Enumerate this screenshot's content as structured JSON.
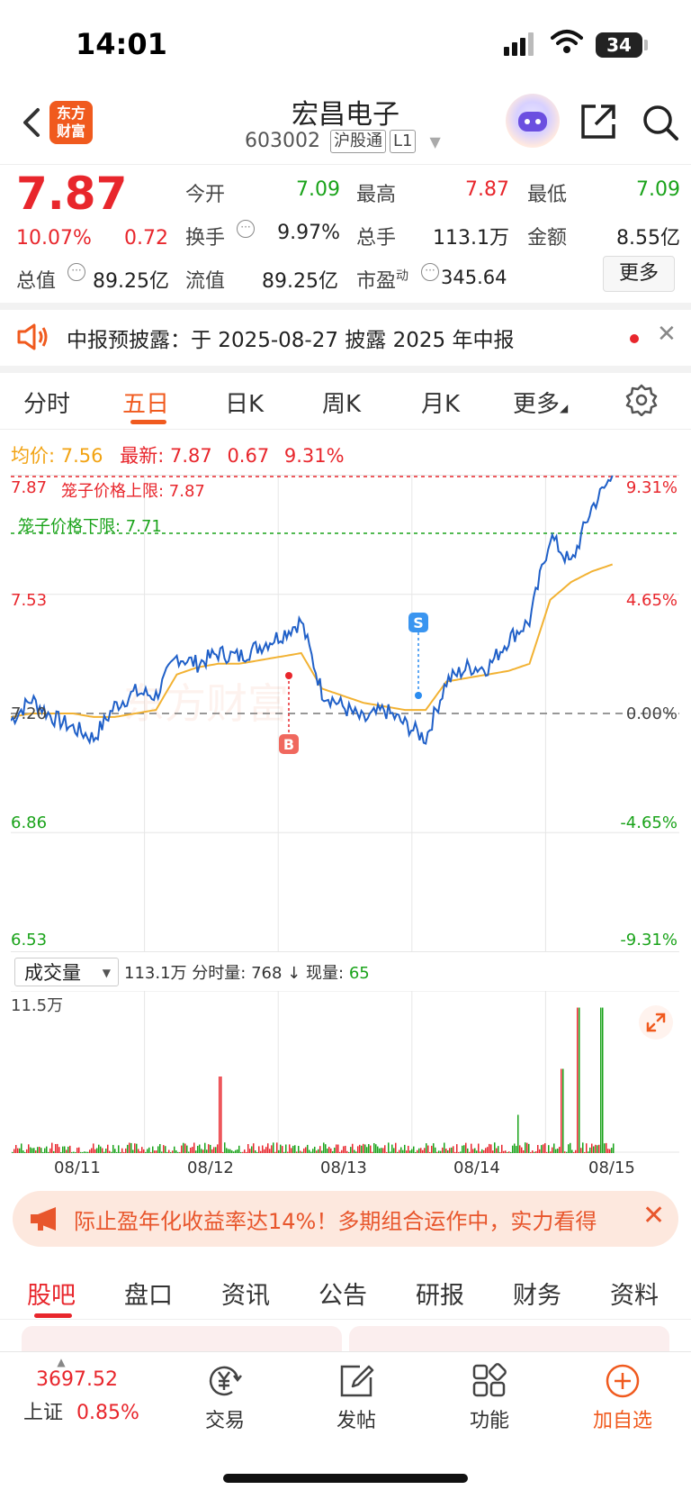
{
  "status_bar": {
    "time": "14:01",
    "battery": "34"
  },
  "header": {
    "logo_line1": "东方",
    "logo_line2": "财富",
    "stock_name": "宏昌电子",
    "stock_code": "603002",
    "tag_connect": "沪股通",
    "tag_level": "L1"
  },
  "quote": {
    "price": "7.87",
    "change_pct": "10.07%",
    "change": "0.72",
    "open_label": "今开",
    "open": "7.09",
    "high_label": "最高",
    "high": "7.87",
    "low_label": "最低",
    "low": "7.09",
    "turnover_label": "换手",
    "turnover": "9.97%",
    "volume_label": "总手",
    "volume": "113.1万",
    "amount_label": "金额",
    "amount": "8.55亿",
    "mktcap_label": "总值",
    "mktcap": "89.25亿",
    "float_label": "流值",
    "float": "89.25亿",
    "pe_label": "市盈",
    "pe_sup": "动",
    "pe": "345.64",
    "more": "更多"
  },
  "notice": {
    "text": "中报预披露：于 2025-08-27 披露 2025 年中报"
  },
  "chart_tabs": [
    "分时",
    "五日",
    "日K",
    "周K",
    "月K",
    "更多"
  ],
  "chart_info": {
    "avg_label": "均价:",
    "avg": "7.56",
    "latest_label": "最新:",
    "latest": "7.87",
    "latest_chg": "0.67",
    "latest_pct": "9.31%"
  },
  "chart_labels": {
    "y_left": [
      "7.87",
      "7.53",
      "7.20",
      "6.86",
      "6.53"
    ],
    "y_right": [
      "9.31%",
      "4.65%",
      "0.00%",
      "-4.65%",
      "-9.31%"
    ],
    "limit_up": "笼子价格上限: 7.87",
    "limit_down": "笼子价格下限: 7.71",
    "marker_buy": "B",
    "marker_sell": "S"
  },
  "volume_panel": {
    "selector": "成交量",
    "total": "113.1万",
    "period_label": "分时量:",
    "period": "768",
    "arrow": "↓",
    "now_label": "现量:",
    "now": "65",
    "y_max": "11.5万"
  },
  "dates": [
    "08/11",
    "08/12",
    "08/13",
    "08/14",
    "08/15"
  ],
  "ad": {
    "text": "际止盈年化收益率达14%！多期组合运作中，实力看得"
  },
  "bottom_tabs": [
    "股吧",
    "盘口",
    "资讯",
    "公告",
    "研报",
    "财务",
    "资料"
  ],
  "bottom_bar": {
    "index_value": "3697.52",
    "index_name": "上证",
    "index_pct": "0.85%",
    "trade": "交易",
    "post": "发帖",
    "features": "功能",
    "add_watch": "加自选"
  },
  "colors": {
    "up": "#e8262c",
    "down": "#1aa31a",
    "accent": "#f05a1e",
    "price_line": "#2060c8",
    "avg_line": "#f2b233"
  },
  "chart_data": {
    "type": "line",
    "x": [
      "08/11",
      "08/12",
      "08/13",
      "08/14",
      "08/15"
    ],
    "series": [
      {
        "values": [
          7.18,
          7.24,
          7.19,
          7.16,
          7.13,
          7.22,
          7.26,
          7.25,
          7.36,
          7.34,
          7.37,
          7.36,
          7.39,
          7.42,
          7.46,
          7.26,
          7.22,
          7.18,
          7.21,
          7.17,
          7.13,
          7.29,
          7.33,
          7.33,
          7.41,
          7.46,
          7.7,
          7.62,
          7.78,
          7.87
        ]
      },
      {
        "values": [
          7.19,
          7.2,
          7.2,
          7.2,
          7.19,
          7.19,
          7.2,
          7.21,
          7.31,
          7.33,
          7.34,
          7.34,
          7.35,
          7.36,
          7.37,
          7.27,
          7.25,
          7.23,
          7.22,
          7.21,
          7.21,
          7.29,
          7.3,
          7.31,
          7.32,
          7.34,
          7.52,
          7.57,
          7.6,
          7.62
        ]
      }
    ],
    "ylim": [
      6.53,
      7.87
    ],
    "y_percent_range": [
      "-9.31%",
      "9.31%"
    ]
  }
}
